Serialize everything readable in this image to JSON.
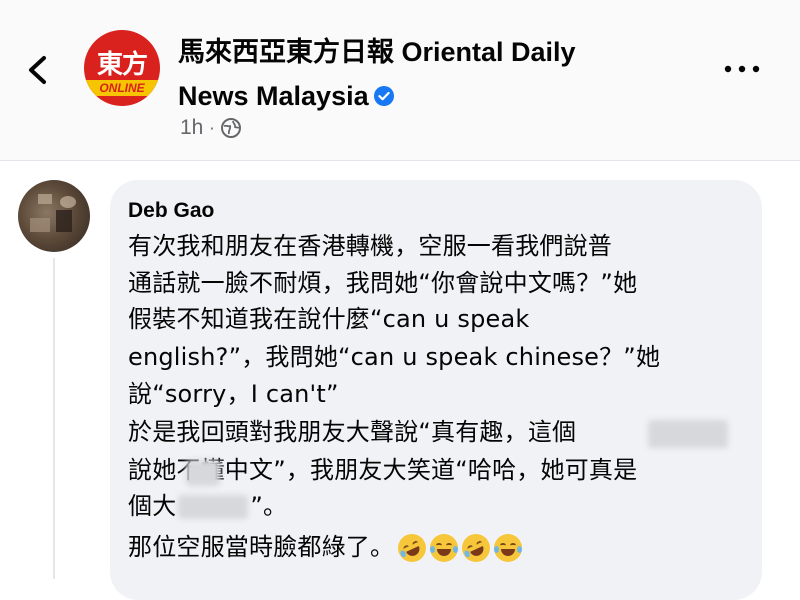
{
  "header": {
    "page_name": "馬來西亞東方日報 Oriental Daily News Malaysia",
    "logo_text_top": "東方",
    "logo_text_band": "ONLINE",
    "time": "1h",
    "privacy_icon": "globe-icon",
    "verified_icon": "verified-badge-icon",
    "back_icon": "chevron-left-icon",
    "more_icon": "more-horizontal-icon"
  },
  "comment": {
    "author": "Deb Gao",
    "lines": [
      "有次我和朋友在香港轉機，空服一看我們說普",
      "通話就一臉不耐煩，我問她“你會說中文嗎？”她",
      "假裝不知道我在說什麼“can u speak",
      "english?”，我問她“can u speak chinese？”她",
      "說“sorry，I can't”",
      "於是我回頭對我朋友大聲說“真有趣，這個",
      "說她不懂中文”，我朋友大笑道“哈哈，她可真是",
      "個大",
      "”。",
      "那位空服當時臉都綠了。"
    ],
    "emojis": [
      "rolling-on-floor-laughing-emoji",
      "tears-of-joy-emoji",
      "rolling-on-floor-laughing-emoji",
      "tears-of-joy-emoji"
    ]
  },
  "colors": {
    "bubble": "#f0f2f5",
    "verified": "#1877f2",
    "secondary_text": "#65676b",
    "logo_red": "#d9211d",
    "logo_yellow": "#f6c400"
  }
}
